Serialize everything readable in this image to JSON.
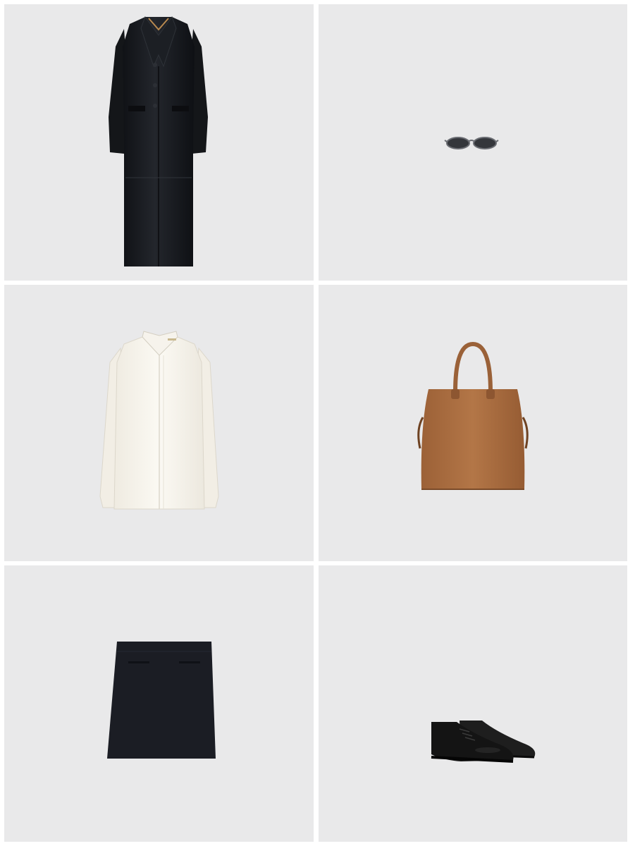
{
  "grid": {
    "columns": 2,
    "rows": 3,
    "tile_background": "#e9e9ea",
    "gutter_color": "#ffffff"
  },
  "items": [
    {
      "item": "long-black-leather-coat",
      "color": "#17191d"
    },
    {
      "item": "oval-sunglasses",
      "color": "#3b3d42"
    },
    {
      "item": "white-button-shirt",
      "color": "#f7f4ec"
    },
    {
      "item": "brown-suede-tote-bag",
      "color": "#a86b3e"
    },
    {
      "item": "black-mini-skirt",
      "color": "#1b1d24"
    },
    {
      "item": "black-leather-oxford-shoes",
      "color": "#141414"
    }
  ]
}
